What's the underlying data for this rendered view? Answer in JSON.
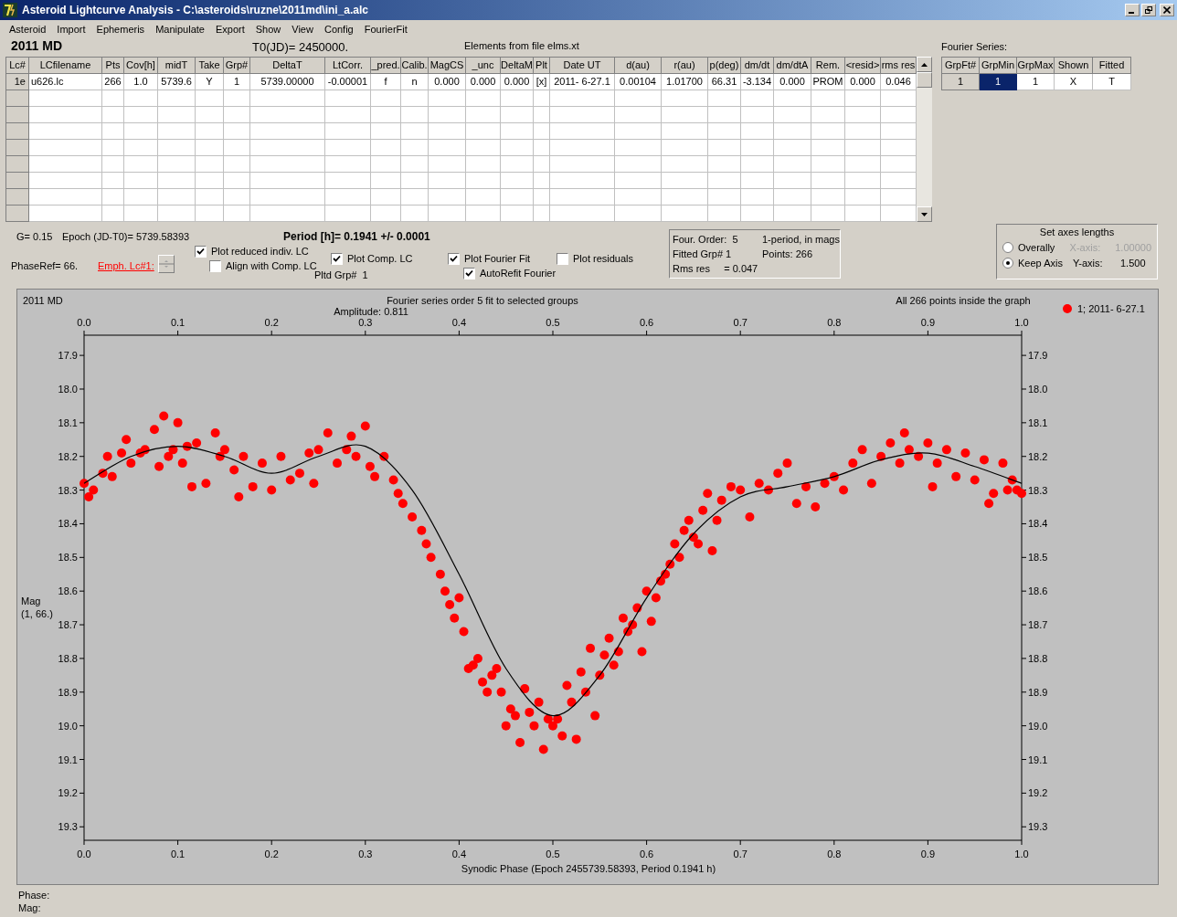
{
  "window": {
    "title": "Asteroid Lightcurve Analysis - C:\\asteroids\\ruzne\\2011md\\ini_a.alc"
  },
  "menu": [
    "Asteroid",
    "Import",
    "Ephemeris",
    "Manipulate",
    "Export",
    "Show",
    "View",
    "Config",
    "FourierFit"
  ],
  "header": {
    "object": "2011 MD",
    "t0": "T0(JD)= 2450000.",
    "elements": "Elements from file elms.xt"
  },
  "lc_table": {
    "columns": [
      "Lc#",
      "LCfilename",
      "Pts",
      "Cov[h]",
      "midT",
      "Take",
      "Grp#",
      "DeltaT",
      "LtCorr.",
      "_pred.",
      "Calib.",
      "MagCS",
      "_unc",
      "DeltaM",
      "Plt",
      "Date UT",
      "d(au)",
      "r(au)",
      "p(deg)",
      "dm/dt",
      "dm/dtA",
      "Rem.",
      "<resid>",
      "rms res"
    ],
    "rows": [
      {
        "cells": [
          "1e",
          "u626.lc",
          "266",
          "1.0",
          "5739.6",
          "Y",
          "1",
          "5739.00000",
          "-0.00001",
          "f",
          "n",
          "0.000",
          "0.000",
          "0.000",
          "[x]",
          "2011- 6-27.1",
          "0.00104",
          "1.01700",
          "66.31",
          "-3.134",
          "0.000",
          "PROM",
          "0.000",
          "0.046"
        ]
      }
    ]
  },
  "fourier": {
    "title": "Fourier Series:",
    "columns": [
      "GrpFt#",
      "GrpMin",
      "GrpMax",
      "Shown",
      "Fitted"
    ],
    "rows": [
      {
        "cells": [
          {
            "text": "1",
            "selected": false
          },
          {
            "text": "1",
            "selected": true
          },
          {
            "text": "1",
            "selected": false
          },
          {
            "text": "X",
            "selected": false
          },
          {
            "text": "T",
            "selected": false
          }
        ]
      }
    ]
  },
  "params": {
    "g": "G= 0.15",
    "epoch": "Epoch (JD-T0)= 5739.58393",
    "period": "Period [h]= 0.1941 +/- 0.0001",
    "phaseref": "PhaseRef= 66.",
    "emph_link": "Emph. Lc#1:",
    "pltd_grp": "Pltd Grp#  1"
  },
  "options": [
    {
      "label": "Plot reduced indiv. LC",
      "checked": true
    },
    {
      "label": "Align with Comp. LC",
      "checked": false
    },
    {
      "label": "Plot Comp. LC",
      "checked": true
    },
    {
      "label": "Plot Fourier Fit",
      "checked": true
    },
    {
      "label": "AutoRefit Fourier",
      "checked": true
    },
    {
      "label": "Plot residuals",
      "checked": false
    }
  ],
  "info": [
    "Four. Order:  5",
    "1-period, in mags",
    "Fitted Grp# 1",
    "Points: 266",
    "Rms res     = 0.047"
  ],
  "axes": {
    "title": "Set axes lengths",
    "options": [
      {
        "label": "Overally",
        "selected": false
      },
      {
        "label": "Keep Axis",
        "selected": true
      }
    ],
    "fields": [
      {
        "label": "X-axis:",
        "value": "1.00000",
        "disabled": true
      },
      {
        "label": "Y-axis:",
        "value": "1.500",
        "disabled": false
      }
    ]
  },
  "chart": {
    "object": "2011 MD",
    "amplitude": "Amplitude: 0.811",
    "note": "All 266 points inside the graph",
    "ylabel_sub": "(1, 66.)",
    "bottom_axis_labels": [
      "0.0",
      "0.1",
      "0.2",
      "0.3",
      "0.4",
      "0.5",
      "0.6",
      "0.7",
      "0.8",
      "0.9",
      "1.0"
    ],
    "left_axis_labels": [
      "17.9",
      "18.0",
      "18.1",
      "18.2",
      "18.3",
      "18.4",
      "18.5",
      "18.6",
      "18.7",
      "18.8",
      "18.9",
      "19.0",
      "19.1",
      "19.2",
      "19.3"
    ],
    "chart_data": {
      "type": "scatter",
      "title": "Fourier series order 5 fit to selected groups",
      "xlabel": "Synodic Phase (Epoch 2455739.58393, Period 0.1941 h)",
      "ylabel": "Mag",
      "xlim": [
        0,
        1
      ],
      "ylim": [
        19.34,
        17.84
      ],
      "xticks": [
        {
          "value": 0,
          "label": "0.0"
        },
        0.1,
        0.2,
        0.3,
        0.4,
        0.5,
        0.6,
        0.7,
        0.8,
        0.9,
        {
          "value": 1,
          "label": "1.0"
        }
      ],
      "yticks": [
        17.9,
        {
          "value": 18,
          "label": "18.0"
        },
        18.1,
        18.2,
        18.3,
        18.4,
        18.5,
        18.6,
        18.7,
        18.8,
        18.9,
        {
          "value": 19,
          "label": "19.0"
        },
        19.1,
        19.2,
        19.3
      ],
      "series": [
        {
          "name": "1; 2011- 6-27.1",
          "type": "scatter",
          "color": "#ff0000",
          "x": [
            0,
            0.005,
            0.01,
            0.02,
            0.025,
            0.03,
            0.04,
            0.045,
            0.05,
            0.06,
            0.065,
            0.075,
            0.08,
            0.085,
            0.09,
            0.095,
            0.1,
            0.105,
            0.11,
            0.115,
            0.12,
            0.13,
            0.14,
            0.145,
            0.15,
            0.16,
            0.165,
            0.17,
            0.18,
            0.19,
            0.2,
            0.21,
            0.22,
            0.23,
            0.24,
            0.245,
            0.25,
            0.26,
            0.27,
            0.28,
            0.285,
            0.29,
            0.3,
            0.305,
            0.31,
            0.32,
            0.33,
            0.335,
            0.34,
            0.35,
            0.36,
            0.365,
            0.37,
            0.38,
            0.385,
            0.39,
            0.395,
            0.4,
            0.405,
            0.41,
            0.415,
            0.42,
            0.425,
            0.43,
            0.435,
            0.44,
            0.445,
            0.45,
            0.455,
            0.46,
            0.465,
            0.47,
            0.475,
            0.48,
            0.485,
            0.49,
            0.495,
            0.5,
            0.505,
            0.51,
            0.515,
            0.52,
            0.525,
            0.53,
            0.535,
            0.54,
            0.545,
            0.55,
            0.555,
            0.56,
            0.565,
            0.57,
            0.575,
            0.58,
            0.585,
            0.59,
            0.595,
            0.6,
            0.605,
            0.61,
            0.615,
            0.62,
            0.625,
            0.63,
            0.635,
            0.64,
            0.645,
            0.65,
            0.655,
            0.66,
            0.665,
            0.67,
            0.675,
            0.68,
            0.69,
            0.7,
            0.71,
            0.72,
            0.73,
            0.74,
            0.75,
            0.76,
            0.77,
            0.78,
            0.79,
            0.8,
            0.81,
            0.82,
            0.83,
            0.84,
            0.85,
            0.86,
            0.87,
            0.875,
            0.88,
            0.89,
            0.9,
            0.905,
            0.91,
            0.92,
            0.93,
            0.94,
            0.95,
            0.96,
            0.965,
            0.97,
            0.98,
            0.985,
            0.99,
            0.995,
            1
          ],
          "values": [
            18.28,
            18.32,
            18.3,
            18.25,
            18.2,
            18.26,
            18.19,
            18.15,
            18.22,
            18.19,
            18.18,
            18.12,
            18.23,
            18.08,
            18.2,
            18.18,
            18.1,
            18.22,
            18.17,
            18.29,
            18.16,
            18.28,
            18.13,
            18.2,
            18.18,
            18.24,
            18.32,
            18.2,
            18.29,
            18.22,
            18.3,
            18.2,
            18.27,
            18.25,
            18.19,
            18.28,
            18.18,
            18.13,
            18.22,
            18.18,
            18.14,
            18.2,
            18.11,
            18.23,
            18.26,
            18.2,
            18.27,
            18.31,
            18.34,
            18.38,
            18.42,
            18.46,
            18.5,
            18.55,
            18.6,
            18.64,
            18.68,
            18.62,
            18.72,
            18.83,
            18.82,
            18.8,
            18.87,
            18.9,
            18.85,
            18.83,
            18.9,
            19.0,
            18.95,
            18.97,
            19.05,
            18.89,
            18.96,
            19.0,
            18.93,
            19.07,
            18.98,
            19.0,
            18.98,
            19.03,
            18.88,
            18.93,
            19.04,
            18.84,
            18.9,
            18.77,
            18.97,
            18.85,
            18.79,
            18.74,
            18.82,
            18.78,
            18.68,
            18.72,
            18.7,
            18.65,
            18.78,
            18.6,
            18.69,
            18.62,
            18.57,
            18.55,
            18.52,
            18.46,
            18.5,
            18.42,
            18.39,
            18.44,
            18.46,
            18.36,
            18.31,
            18.48,
            18.39,
            18.33,
            18.29,
            18.3,
            18.38,
            18.28,
            18.3,
            18.25,
            18.22,
            18.34,
            18.29,
            18.35,
            18.28,
            18.26,
            18.3,
            18.22,
            18.18,
            18.28,
            18.2,
            18.16,
            18.22,
            18.13,
            18.18,
            18.2,
            18.16,
            18.29,
            18.22,
            18.18,
            18.26,
            18.19,
            18.27,
            18.21,
            18.34,
            18.31,
            18.22,
            18.3,
            18.27,
            18.3,
            18.31
          ]
        },
        {
          "type": "line",
          "color": "#000000",
          "x": [
            0,
            0.05,
            0.1,
            0.15,
            0.2,
            0.25,
            0.3,
            0.35,
            0.4,
            0.45,
            0.5,
            0.55,
            0.6,
            0.65,
            0.7,
            0.75,
            0.8,
            0.85,
            0.9,
            0.95,
            1
          ],
          "values": [
            18.28,
            18.2,
            18.17,
            18.2,
            18.25,
            18.2,
            18.17,
            18.3,
            18.55,
            18.83,
            18.97,
            18.85,
            18.62,
            18.43,
            18.32,
            18.29,
            18.26,
            18.21,
            18.19,
            18.23,
            18.28
          ]
        }
      ]
    }
  },
  "status": [
    "Phase:",
    "Mag:"
  ]
}
